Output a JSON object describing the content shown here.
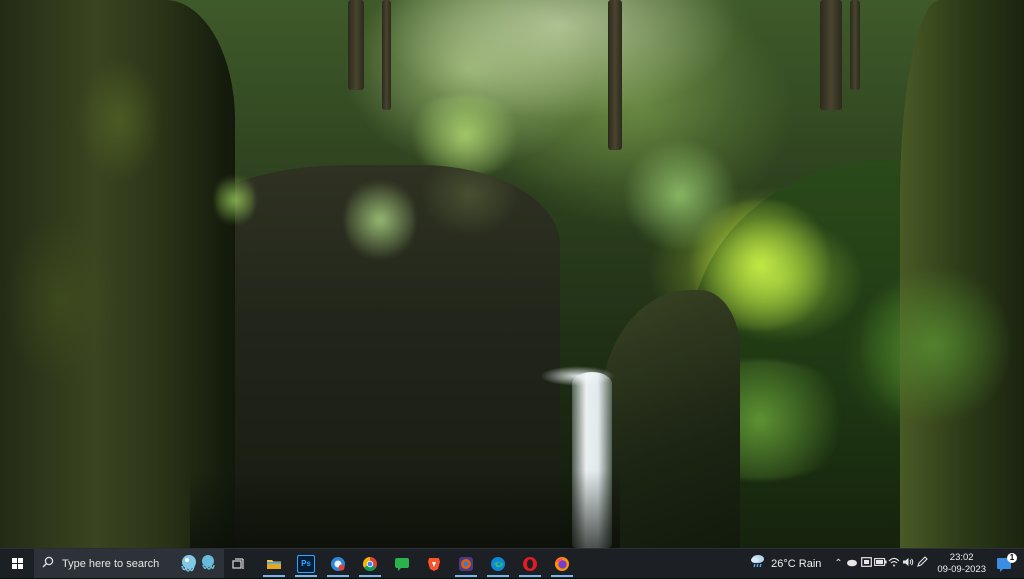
{
  "desktop": {
    "wallpaper": "forest-canyon-waterfall"
  },
  "taskbar": {
    "start_icon": "windows-logo-icon",
    "search": {
      "placeholder": "Type here to search",
      "highlight_icon": "search-highlight-art-icon"
    },
    "task_view_icon": "task-view-icon",
    "pinned_apps": [
      {
        "name": "File Explorer",
        "icon": "folder-icon",
        "running": true
      },
      {
        "name": "Photoshop",
        "icon": "photoshop-icon",
        "label": "Ps",
        "running": true
      },
      {
        "name": "Browser",
        "icon": "browser-icon",
        "running": true
      },
      {
        "name": "Google Chrome",
        "icon": "chrome-icon",
        "running": true
      },
      {
        "name": "Messenger",
        "icon": "chat-icon",
        "running": false
      },
      {
        "name": "Brave",
        "icon": "brave-icon",
        "running": false
      },
      {
        "name": "Firefox Developer",
        "icon": "firefox-dev-icon",
        "running": true
      },
      {
        "name": "Microsoft Edge",
        "icon": "edge-icon",
        "running": true
      },
      {
        "name": "Opera",
        "icon": "opera-icon",
        "running": true
      },
      {
        "name": "Firefox",
        "icon": "firefox-icon",
        "running": true
      }
    ],
    "tray": {
      "weather": {
        "icon": "rain-cloud-icon",
        "text": "26°C  Rain"
      },
      "icons": [
        "chevron-up-icon",
        "cloud-icon",
        "tablet-icon",
        "battery-icon",
        "wifi-icon",
        "speaker-icon",
        "pen-icon"
      ],
      "clock": {
        "time": "23:02",
        "date": "09-09-2023"
      },
      "notifications": {
        "icon": "notification-center-icon",
        "count": "1"
      }
    },
    "colors": {
      "background": "#1c1f24",
      "search_background": "#2d3138",
      "running_indicator": "#76b9ed"
    }
  }
}
